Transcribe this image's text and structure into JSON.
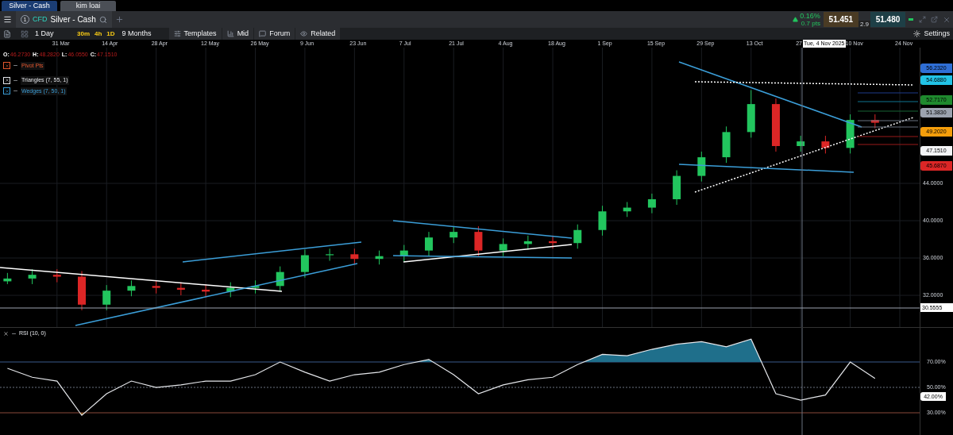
{
  "window_tabs": [
    {
      "label": "Silver - Cash",
      "selected": true
    },
    {
      "label": "kim loai",
      "selected": false
    }
  ],
  "title_bar": {
    "number": "1",
    "type_badge": "CFD",
    "instrument": "Silver - Cash",
    "change_percent": "0.16%",
    "change_points": "0.7 pts",
    "sell": "51.451",
    "spread": "2.9",
    "buy": "51.480"
  },
  "toolbar": {
    "interval": "1 Day",
    "quick_intervals": [
      "30m",
      "4h",
      "1D"
    ],
    "range": "9 Months",
    "buttons": [
      "Templates",
      "Mid",
      "Forum",
      "Related"
    ],
    "settings": "Settings"
  },
  "crosshair_date": "Tue, 4 Nov 2025",
  "legend": {
    "ohlc": [
      {
        "key": "O:",
        "value": "46.2730"
      },
      {
        "key": "H:",
        "value": "48.2820"
      },
      {
        "key": "L:",
        "value": "46.0550"
      },
      {
        "key": "C:",
        "value": "47.1510"
      }
    ],
    "studies": [
      {
        "name": "Pivot Pts",
        "color": "#e4572e"
      },
      {
        "name": "Triangles (7, 55, 1)",
        "color": "#e5e7eb"
      },
      {
        "name": "Wedges (7, 50, 1)",
        "color": "#3b9ed8"
      }
    ]
  },
  "price_chart": {
    "chart_data": {
      "type": "candlestick",
      "categories": [
        null,
        null,
        "31 Mar",
        null,
        "14 Apr",
        null,
        "28 Apr",
        null,
        "12 May",
        null,
        "26 May",
        null,
        "9 Jun",
        null,
        "23 Jun",
        null,
        "7 Jul",
        null,
        "21 Jul",
        null,
        "4 Aug",
        null,
        "18 Aug",
        null,
        "1 Sep",
        null,
        "15 Sep",
        null,
        "29 Sep",
        null,
        "13 Oct",
        null,
        "27",
        null,
        "10 Nov",
        null,
        "24 Nov"
      ],
      "ohlc": [
        [
          33.5,
          34.4,
          33.2,
          33.8
        ],
        [
          33.8,
          34.8,
          33.2,
          34.2
        ],
        [
          34.2,
          34.8,
          33.4,
          34.0
        ],
        [
          34.0,
          34.6,
          30.4,
          31.0
        ],
        [
          31.0,
          33.1,
          30.4,
          32.5
        ],
        [
          32.5,
          33.6,
          31.9,
          33.0
        ],
        [
          33.0,
          33.6,
          32.2,
          32.8
        ],
        [
          32.8,
          33.4,
          32.0,
          32.6
        ],
        [
          32.6,
          33.2,
          31.8,
          32.4
        ],
        [
          32.4,
          33.4,
          31.8,
          32.8
        ],
        [
          32.8,
          33.6,
          32.2,
          33.0
        ],
        [
          33.0,
          35.1,
          32.4,
          34.5
        ],
        [
          34.5,
          36.9,
          33.9,
          36.3
        ],
        [
          36.3,
          37.0,
          35.7,
          36.4
        ],
        [
          36.4,
          37.0,
          35.3,
          35.9
        ],
        [
          35.9,
          36.8,
          35.3,
          36.2
        ],
        [
          36.2,
          37.4,
          35.6,
          36.8
        ],
        [
          36.8,
          38.8,
          36.2,
          38.2
        ],
        [
          38.2,
          39.4,
          37.6,
          38.8
        ],
        [
          38.8,
          39.4,
          36.2,
          36.8
        ],
        [
          36.8,
          38.1,
          36.2,
          37.5
        ],
        [
          37.5,
          38.4,
          36.9,
          37.8
        ],
        [
          37.8,
          38.4,
          37.0,
          37.6
        ],
        [
          37.6,
          39.6,
          37.0,
          39.0
        ],
        [
          39.0,
          41.6,
          38.4,
          41.0
        ],
        [
          41.0,
          42.0,
          40.4,
          41.4
        ],
        [
          41.4,
          42.9,
          40.8,
          42.3
        ],
        [
          42.3,
          45.4,
          41.7,
          44.8
        ],
        [
          44.8,
          47.4,
          44.2,
          46.8
        ],
        [
          46.8,
          50.1,
          46.2,
          49.5
        ],
        [
          49.5,
          54.0,
          48.9,
          52.5
        ],
        [
          52.5,
          53.1,
          47.4,
          48.0
        ],
        [
          48.0,
          49.1,
          47.4,
          48.5
        ],
        [
          48.5,
          49.1,
          47.2,
          47.8
        ],
        [
          47.8,
          51.4,
          47.2,
          50.8
        ],
        [
          50.8,
          51.4,
          49.9,
          50.5
        ],
        null
      ],
      "ylim": [
        28.6,
        58.55
      ],
      "grid": true,
      "yticks": [
        {
          "value": 32,
          "label": "32.0000"
        },
        {
          "value": 36,
          "label": "36.0000"
        },
        {
          "value": 40,
          "label": "40.0000"
        },
        {
          "value": 44,
          "label": "44.0000"
        }
      ]
    },
    "price_tags": [
      {
        "value": "56.2320",
        "color": "#2f6fd6"
      },
      {
        "value": "54.6880",
        "color": "#22c3e6"
      },
      {
        "value": "52.7170",
        "color": "#1f8a2e"
      },
      {
        "value": "51.3830",
        "color": "#9ca3af"
      },
      {
        "value": "49.2020",
        "color": "#f59e0b"
      },
      {
        "value": "47.1510",
        "color": "#f3f4f6"
      },
      {
        "value": "45.6870",
        "color": "#dc2626"
      }
    ],
    "crosshair_price": "30.5555"
  },
  "rsi": {
    "chart_data": {
      "type": "line",
      "categories": [
        null,
        null,
        null,
        null,
        null,
        null,
        null,
        null,
        null,
        null,
        null,
        null,
        null,
        null,
        null,
        null,
        null,
        null,
        null,
        null,
        null,
        null,
        null,
        null,
        null,
        null,
        null,
        null,
        null,
        null,
        null,
        null,
        null,
        null,
        null,
        null,
        null
      ],
      "series": [
        {
          "name": "RSI (10, 0)",
          "color": "#e5e7eb",
          "values": [
            65,
            58,
            55,
            28,
            45,
            55,
            50,
            52,
            55,
            55,
            60,
            70,
            62,
            55,
            60,
            62,
            68,
            72,
            60,
            45,
            52,
            56,
            58,
            68,
            76,
            75,
            80,
            84,
            86,
            82,
            88,
            45,
            40,
            44,
            70,
            57,
            null
          ]
        }
      ],
      "ylim": [
        11.9,
        96.9
      ],
      "yticks": [
        {
          "value": 30,
          "label": "30.00%"
        },
        {
          "value": 50,
          "label": "50.00%"
        },
        {
          "value": 70,
          "label": "70.00%"
        }
      ]
    },
    "current_tag": "42.00%"
  }
}
